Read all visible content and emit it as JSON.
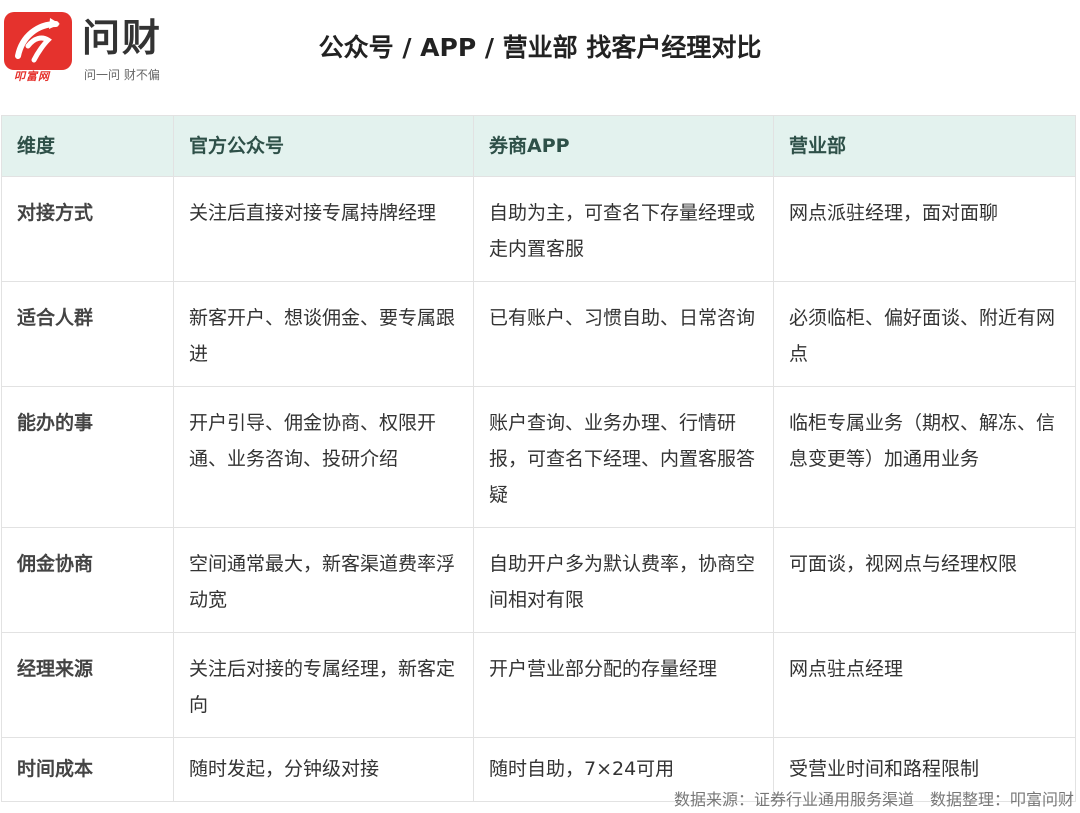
{
  "header": {
    "logo_name": "问财",
    "logo_brand": "叩富网",
    "logo_slogan": "问一问 财不偏",
    "title": "公众号 / APP / 营业部 找客户经理对比"
  },
  "table": {
    "columns": [
      "维度",
      "官方公众号",
      "券商APP",
      "营业部"
    ],
    "rows": [
      {
        "label": "对接方式",
        "cells": [
          "关注后直接对接专属持牌经理",
          "自助为主，可查名下存量经理或走内置客服",
          "网点派驻经理，面对面聊"
        ]
      },
      {
        "label": "适合人群",
        "cells": [
          "新客开户、想谈佣金、要专属跟进",
          "已有账户、习惯自助、日常咨询",
          "必须临柜、偏好面谈、附近有网点"
        ]
      },
      {
        "label": "能办的事",
        "cells": [
          "开户引导、佣金协商、权限开通、业务咨询、投研介绍",
          "账户查询、业务办理、行情研报，可查名下经理、内置客服答疑",
          "临柜专属业务（期权、解冻、信息变更等）加通用业务"
        ]
      },
      {
        "label": "佣金协商",
        "cells": [
          "空间通常最大，新客渠道费率浮动宽",
          "自助开户多为默认费率，协商空间相对有限",
          "可面谈，视网点与经理权限"
        ]
      },
      {
        "label": "经理来源",
        "cells": [
          "关注后对接的专属经理，新客定向",
          "开户营业部分配的存量经理",
          "网点驻点经理"
        ]
      },
      {
        "label": "时间成本",
        "cells": [
          "随时发起，分钟级对接",
          "随时自助，7×24可用",
          "受营业时间和路程限制"
        ]
      }
    ]
  },
  "footer": {
    "source": "数据来源：证券行业通用服务渠道　数据整理：叩富问财"
  },
  "colors": {
    "brand_red": "#e5322d",
    "header_bg": "#e3f2ee",
    "header_text": "#2e5048"
  }
}
